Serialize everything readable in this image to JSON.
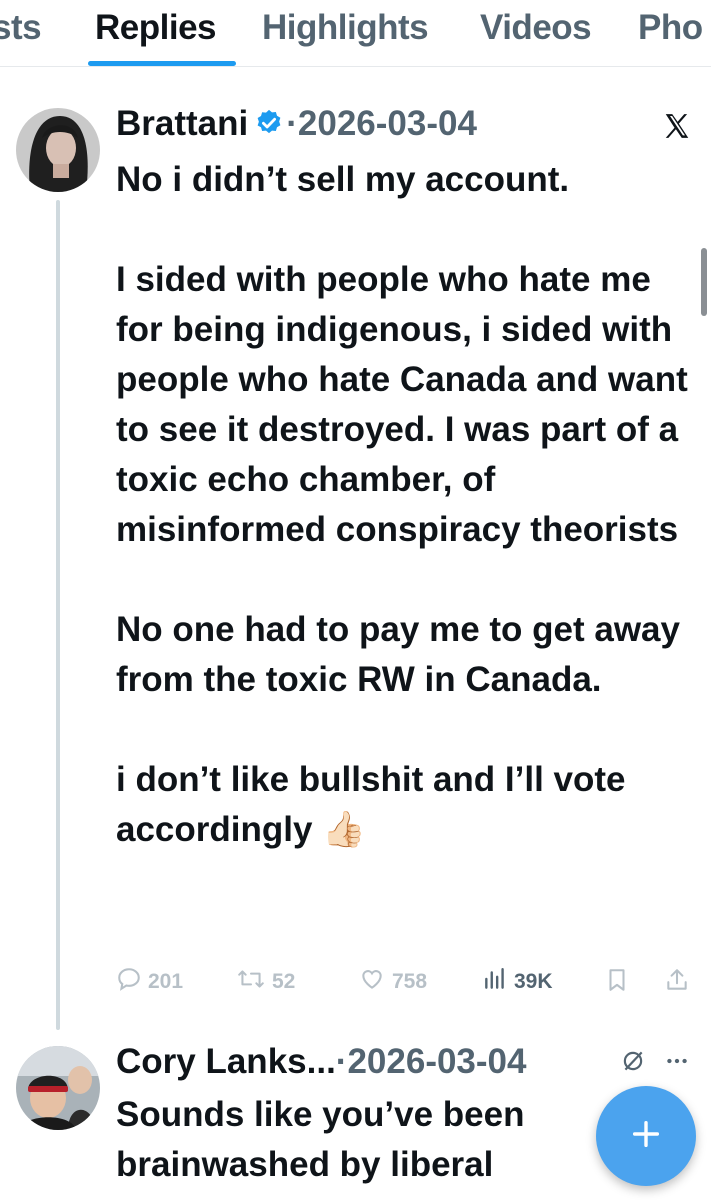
{
  "tabs": [
    {
      "label": "sts",
      "active": false
    },
    {
      "label": "Replies",
      "active": true
    },
    {
      "label": "Highlights",
      "active": false
    },
    {
      "label": "Videos",
      "active": false
    },
    {
      "label": "Pho",
      "active": false
    }
  ],
  "tweet": {
    "author": "Brattani",
    "separator": "·",
    "date": "2026-03-04",
    "verified_icon": "verified-badge-icon",
    "platform_icon": "x-logo-icon",
    "paragraphs": [
      "No i didn’t sell my account.",
      "I sided with people who hate me for being indigenous, i sided with people who hate Canada and want to see it destroyed. I was part of a toxic echo chamber, of misinformed conspiracy theorists",
      "No one had to pay me to get away from the toxic RW in Canada.",
      "i don’t like bullshit and I’ll vote accordingly"
    ],
    "emoji": "👍🏻",
    "replies": "201",
    "retweets": "52",
    "likes": "758",
    "views": "39K"
  },
  "reply": {
    "author": "Cory Lanks...",
    "separator": "·",
    "date": "2026-03-04",
    "lines": [
      "Sounds like you’ve been",
      "brainwashed by liberal"
    ]
  },
  "colors": {
    "accent": "#1d9bf0",
    "fab": "#4ba3ee",
    "muted": "#536471"
  }
}
